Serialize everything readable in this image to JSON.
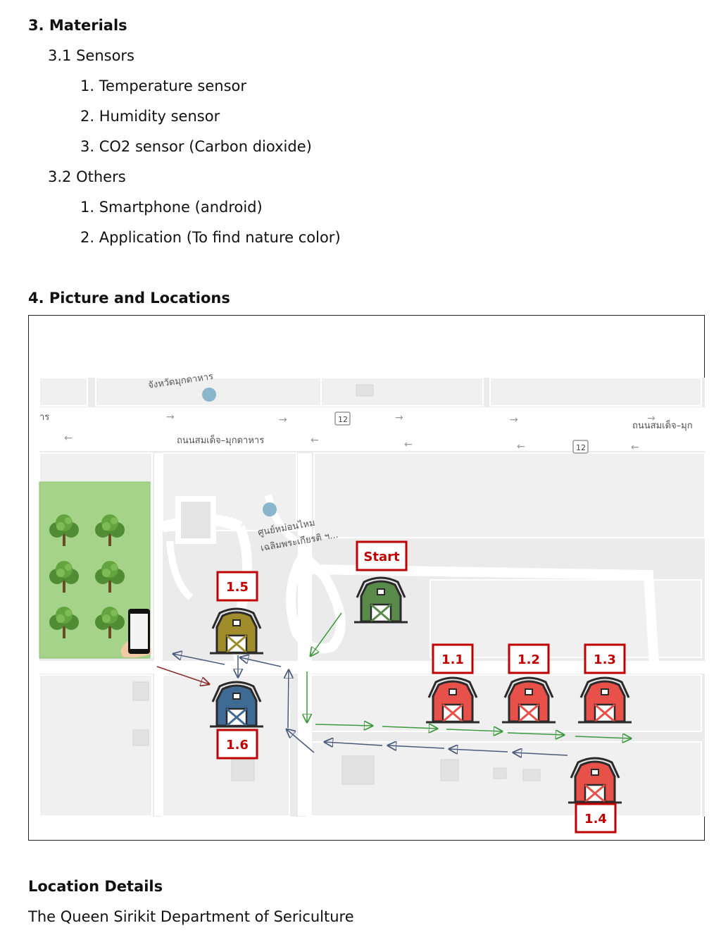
{
  "materials": {
    "heading": "3. Materials",
    "sensors_heading": "3.1 Sensors",
    "sensors": [
      "1. Temperature sensor",
      "2. Humidity sensor",
      "3. CO2 sensor (Carbon dioxide)"
    ],
    "others_heading": "3.2 Others",
    "others": [
      "1. Smartphone (android)",
      "2. Application (To find nature color)"
    ]
  },
  "pictures": {
    "heading": "4. Picture and Locations",
    "map": {
      "road_label_left": "ถนนสมเด็จ–มุกดาหาร",
      "road_label_right": "ถนนสมเด็จ–มุก",
      "road_label_edge": "าร",
      "poi_top": "จังหวัดมุกดาหาร",
      "poi_center_line1": "ศูนย์หม่อนไหม",
      "poi_center_line2": "เฉลิมพระเกียรติ ฯ...",
      "route_badge": "12",
      "start_label": "Start",
      "stations": [
        "1.1",
        "1.2",
        "1.3",
        "1.4",
        "1.5",
        "1.6"
      ],
      "colors": {
        "start_barn": "#5a8a4a",
        "red_barn": "#e8504a",
        "yellow_barn": "#a08c2a",
        "blue_barn": "#3f6a94",
        "badge_border": "#c00000",
        "green_arrow": "#3c9a3c",
        "blue_arrow": "#4a5a7a",
        "red_arrow": "#8a2a2a",
        "tree_area": "#a6d38a"
      }
    }
  },
  "location": {
    "heading": "Location Details",
    "text": "The Queen Sirikit Department of Sericulture"
  }
}
